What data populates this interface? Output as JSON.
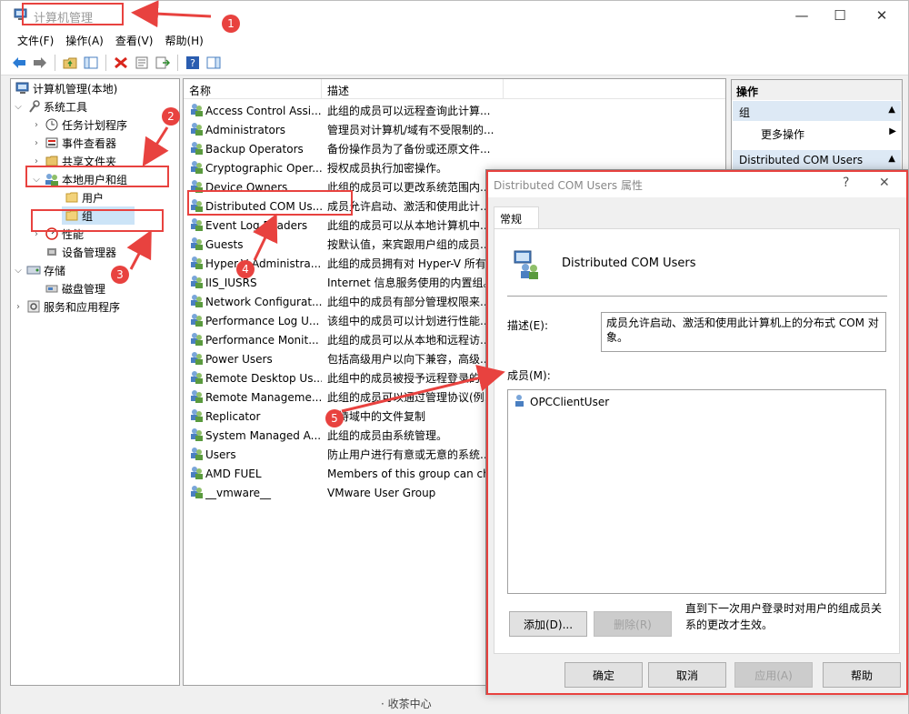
{
  "window": {
    "title": "计算机管理",
    "controls": {
      "minimize": "—",
      "maximize": "☐",
      "close": "✕"
    }
  },
  "menu": [
    "文件(F)",
    "操作(A)",
    "查看(V)",
    "帮助(H)"
  ],
  "tree": {
    "root": "计算机管理(本地)",
    "system_tools": "系统工具",
    "task_scheduler": "任务计划程序",
    "event_viewer": "事件查看器",
    "shared_folders": "共享文件夹",
    "local_users_groups": "本地用户和组",
    "users": "用户",
    "groups": "组",
    "performance": "性能",
    "device_manager": "设备管理器",
    "storage": "存储",
    "disk_management": "磁盘管理",
    "services_apps": "服务和应用程序"
  },
  "list": {
    "columns": {
      "name": "名称",
      "description": "描述"
    },
    "rows": [
      {
        "name": "Access Control Assi...",
        "description": "此组的成员可以远程查询此计算..."
      },
      {
        "name": "Administrators",
        "description": "管理员对计算机/域有不受限制的..."
      },
      {
        "name": "Backup Operators",
        "description": "备份操作员为了备份或还原文件..."
      },
      {
        "name": "Cryptographic Oper...",
        "description": "授权成员执行加密操作。"
      },
      {
        "name": "Device Owners",
        "description": "此组的成员可以更改系统范围内..."
      },
      {
        "name": "Distributed COM Us...",
        "description": "成员允许启动、激活和使用此计..."
      },
      {
        "name": "Event Log Readers",
        "description": "此组的成员可以从本地计算机中..."
      },
      {
        "name": "Guests",
        "description": "按默认值，来宾跟用户组的成员..."
      },
      {
        "name": "Hyper-V Administra...",
        "description": "此组的成员拥有对 Hyper-V 所有..."
      },
      {
        "name": "IIS_IUSRS",
        "description": "Internet 信息服务使用的内置组。"
      },
      {
        "name": "Network Configurat...",
        "description": "此组中的成员有部分管理权限来..."
      },
      {
        "name": "Performance Log U...",
        "description": "该组中的成员可以计划进行性能..."
      },
      {
        "name": "Performance Monit...",
        "description": "此组的成员可以从本地和远程访..."
      },
      {
        "name": "Power Users",
        "description": "包括高级用户以向下兼容，高级..."
      },
      {
        "name": "Remote Desktop Us...",
        "description": "此组中的成员被授予远程登录的..."
      },
      {
        "name": "Remote Manageme...",
        "description": "此组的成员可以通过管理协议(例..."
      },
      {
        "name": "Replicator",
        "description": "支持域中的文件复制"
      },
      {
        "name": "System Managed A...",
        "description": "此组的成员由系统管理。"
      },
      {
        "name": "Users",
        "description": "防止用户进行有意或无意的系统..."
      },
      {
        "name": "AMD FUEL",
        "description": "Members of this group can ch..."
      },
      {
        "name": "__vmware__",
        "description": "VMware User Group"
      }
    ]
  },
  "actions": {
    "title": "操作",
    "section1": "组",
    "more_actions": "更多操作",
    "section2": "Distributed COM Users"
  },
  "dialog": {
    "title": "Distributed COM Users 属性",
    "help": "?",
    "close": "✕",
    "tab": "常规",
    "group_name": "Distributed COM Users",
    "description_label": "描述(E):",
    "description_value": "成员允许启动、激活和使用此计算机上的分布式 COM 对象。",
    "members_label": "成员(M):",
    "members": [
      "OPCClientUser"
    ],
    "add_button": "添加(D)...",
    "remove_button": "删除(R)",
    "note": "直到下一次用户登录时对用户的组成员关系的更改才生效。",
    "ok_button": "确定",
    "cancel_button": "取消",
    "apply_button": "应用(A)",
    "help_button": "帮助"
  },
  "annotations": {
    "num1": "1",
    "num2": "2",
    "num3": "3",
    "num4": "4",
    "num5": "5"
  },
  "bottom": {
    "text": "· 收茶中心"
  },
  "colors": {
    "annotation": "#e8423f",
    "selection": "#dde9f5"
  }
}
